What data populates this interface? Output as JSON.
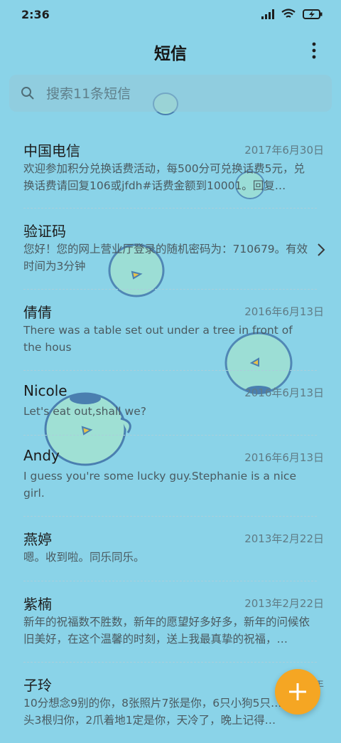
{
  "status_bar": {
    "time": "2:36"
  },
  "header": {
    "title": "短信"
  },
  "search": {
    "placeholder": "搜索11条短信"
  },
  "messages": [
    {
      "name": "中国电信",
      "date": "2017年6月30日",
      "preview": "欢迎参加积分兑换话费活动，每500分可兑换话费5元，兑换话费请回复106或jfdh#话费金额到10001。回复…"
    },
    {
      "name": "验证码",
      "date": "",
      "preview": "您好！您的网上营业厅登录的随机密码为：710679。有效时间为3分钟"
    },
    {
      "name": "倩倩",
      "date": "2016年6月13日",
      "preview": "There was a table set out under a tree in front of the hous"
    },
    {
      "name": "Nicole",
      "date": "2016年6月13日",
      "preview": "Let's eat out,shall we?"
    },
    {
      "name": "Andy",
      "date": "2016年6月13日",
      "preview": "I guess you're some lucky guy.Stephanie is a nice girl."
    },
    {
      "name": "燕婷",
      "date": "2013年2月22日",
      "preview": "嗯。收到啦。同乐同乐。"
    },
    {
      "name": "紫楠",
      "date": "2013年2月22日",
      "preview": "新年的祝福数不胜数，新年的愿望好多好多，新年的问候依旧美好，在这个温馨的时刻，送上我最真挚的祝福，…"
    },
    {
      "name": "子玲",
      "date": "2013年",
      "preview": "10分想念9别的你，8张照片7张是你，6只小狗5只…4根骨头3根归你，2爪着地1定是你，天冷了，晚上记得…"
    }
  ],
  "colors": {
    "background": "#8ad3e8",
    "fab": "#f5a623"
  },
  "icons": {
    "signal": "signal-icon",
    "wifi": "wifi-icon",
    "battery": "battery-charging-icon",
    "more": "more-vertical-icon",
    "search": "search-icon",
    "fab": "plus-icon",
    "chevron": "chevron-right-icon"
  }
}
